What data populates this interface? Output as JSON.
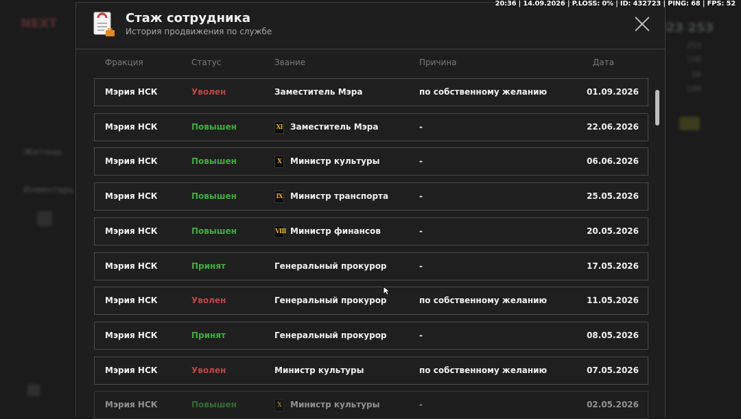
{
  "hud": {
    "status_line": "20:36 | 14.09.2026 | P.LOSS: 0% | ID: 432723 | PING: 68 | FPS: 52"
  },
  "background": {
    "brand": "NEXT",
    "label_tokens": "Жетоны",
    "label_inventory": "Инвентарь",
    "money": "023 253",
    "stats": [
      "253",
      "100",
      "56",
      "100"
    ]
  },
  "modal": {
    "title": "Стаж сотрудника",
    "subtitle": "История продвижения по службе"
  },
  "columns": {
    "faction": "Фракция",
    "status": "Статус",
    "rank": "Звание",
    "reason": "Причина",
    "date": "Дата"
  },
  "rows": [
    {
      "faction": "Мэрия НСК",
      "status": "Уволен",
      "status_type": "fired",
      "badge": "",
      "rank": "Заместитель Мэра",
      "reason": "по собственному желанию",
      "date": "01.09.2026"
    },
    {
      "faction": "Мэрия НСК",
      "status": "Повышен",
      "status_type": "up",
      "badge": "XI",
      "rank": "Заместитель Мэра",
      "reason": "-",
      "date": "22.06.2026"
    },
    {
      "faction": "Мэрия НСК",
      "status": "Повышен",
      "status_type": "up",
      "badge": "X",
      "rank": "Министр культуры",
      "reason": "-",
      "date": "06.06.2026"
    },
    {
      "faction": "Мэрия НСК",
      "status": "Повышен",
      "status_type": "up",
      "badge": "IX",
      "rank": "Министр транспорта",
      "reason": "-",
      "date": "25.05.2026"
    },
    {
      "faction": "Мэрия НСК",
      "status": "Повышен",
      "status_type": "up",
      "badge": "VIII",
      "rank": "Министр финансов",
      "reason": "-",
      "date": "20.05.2026"
    },
    {
      "faction": "Мэрия НСК",
      "status": "Принят",
      "status_type": "hired",
      "badge": "",
      "rank": "Генеральный прокурор",
      "reason": "-",
      "date": "17.05.2026"
    },
    {
      "faction": "Мэрия НСК",
      "status": "Уволен",
      "status_type": "fired",
      "badge": "",
      "rank": "Генеральный прокурор",
      "reason": "по собственному желанию",
      "date": "11.05.2026"
    },
    {
      "faction": "Мэрия НСК",
      "status": "Принят",
      "status_type": "hired",
      "badge": "",
      "rank": "Генеральный прокурор",
      "reason": "-",
      "date": "08.05.2026"
    },
    {
      "faction": "Мэрия НСК",
      "status": "Уволен",
      "status_type": "fired",
      "badge": "",
      "rank": "Министр культуры",
      "reason": "по собственному желанию",
      "date": "07.05.2026"
    },
    {
      "faction": "Мэрия НСК",
      "status": "Повышен",
      "status_type": "up",
      "badge": "X",
      "rank": "Министр культуры",
      "reason": "-",
      "date": "02.05.2026"
    }
  ],
  "colors": {
    "fired": "#c04545",
    "promoted": "#3fae3f",
    "hired": "#3fae3f",
    "badge": "#e0b02a"
  },
  "icons": {
    "header_icon": "document-icon",
    "close": "close-icon"
  }
}
